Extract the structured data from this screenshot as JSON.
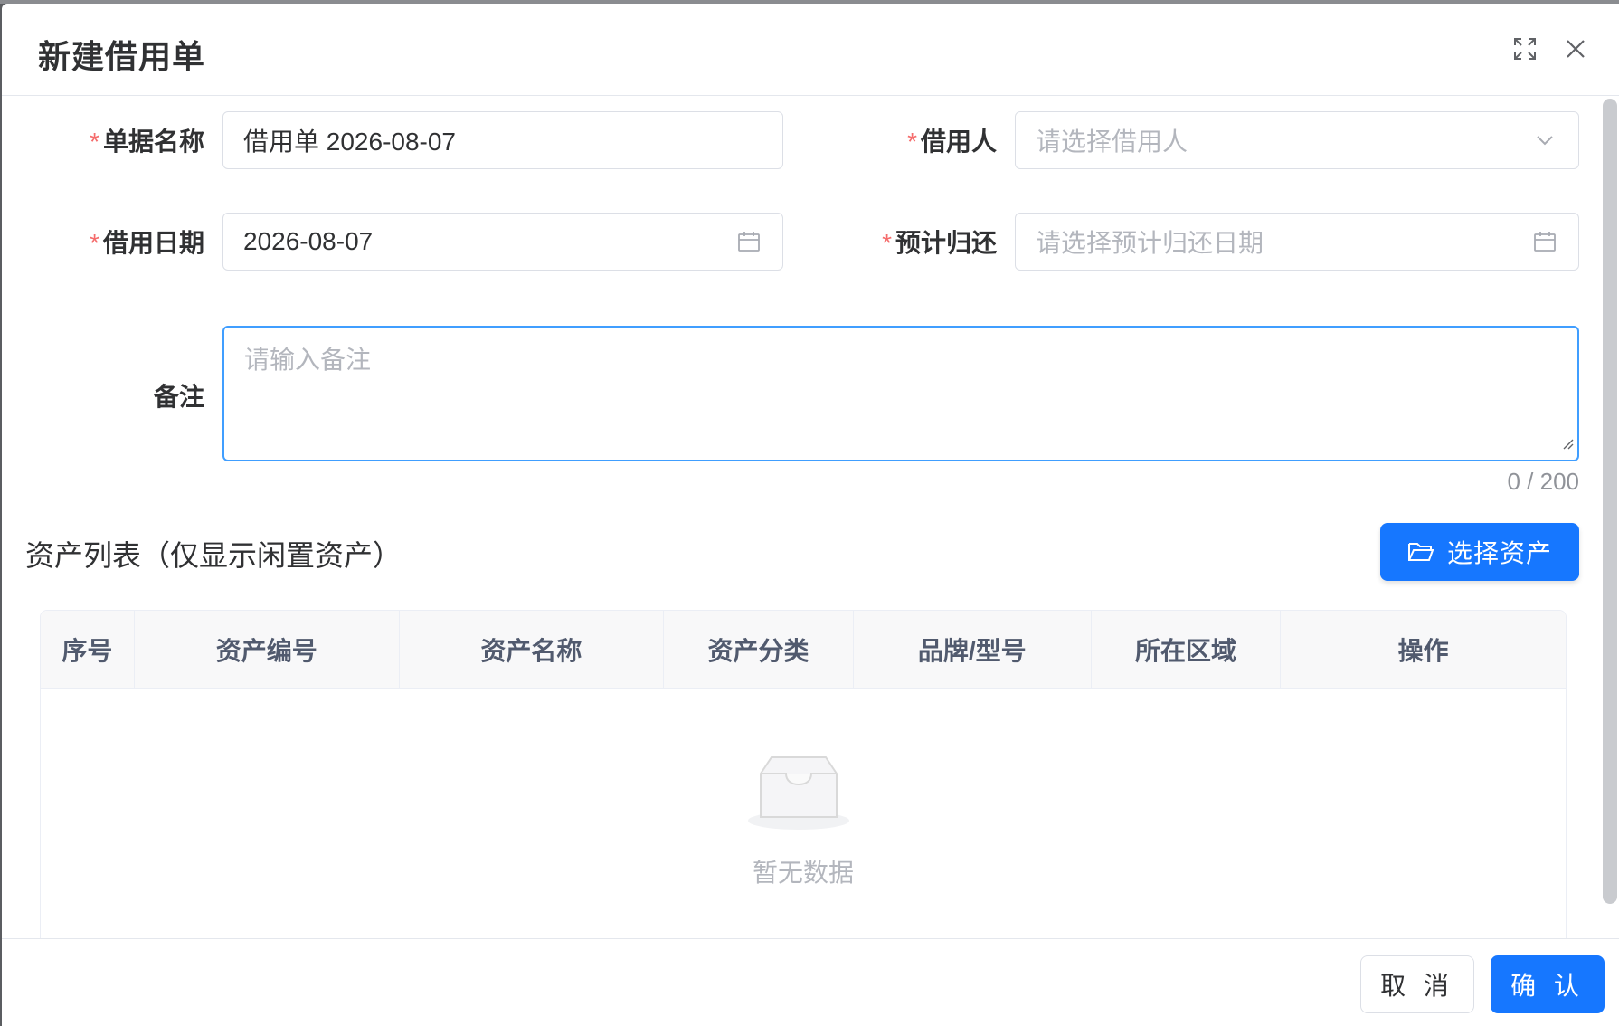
{
  "dialog": {
    "title": "新建借用单"
  },
  "form": {
    "doc_name": {
      "label": "单据名称",
      "required": true,
      "value": "借用单 2026-08-07"
    },
    "borrower": {
      "label": "借用人",
      "required": true,
      "placeholder": "请选择借用人"
    },
    "borrow_date": {
      "label": "借用日期",
      "required": true,
      "value": "2026-08-07"
    },
    "expected_return": {
      "label": "预计归还",
      "required": true,
      "placeholder": "请选择预计归还日期"
    },
    "remark": {
      "label": "备注",
      "placeholder": "请输入备注",
      "counter": "0 / 200"
    }
  },
  "assets": {
    "section_title": "资产列表（仅显示闲置资产）",
    "select_button": "选择资产",
    "columns": [
      "序号",
      "资产编号",
      "资产名称",
      "资产分类",
      "品牌/型号",
      "所在区域",
      "操作"
    ],
    "rows": [],
    "empty_text": "暂无数据"
  },
  "footer": {
    "cancel": "取 消",
    "confirm": "确 认"
  },
  "icons": {
    "fullscreen": "fullscreen-icon",
    "close": "close-icon",
    "dropdown": "chevron-down-icon",
    "calendar": "calendar-icon",
    "folder": "folder-open-icon",
    "empty": "empty-inbox-icon"
  },
  "colors": {
    "primary": "#1677ff",
    "focus_border": "#409eff",
    "required": "#f56c6c"
  }
}
